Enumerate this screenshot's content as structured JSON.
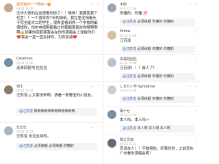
{
  "left_column": [
    {
      "username": "最爱我的个个啊咖~",
      "verified": true,
      "time": "03-24 11:06",
      "text": "汪洋大表的在这里看到你了！！啾咪！我要我我个代言！！一个喜欢你7年的妹纸，我在里沈阳看乐不完全能大二的学生，很希望看到你一个学校的都很想你，你的电视剧都看过的我都很喜欢你哪啊啊啊👍如果你回复我我会在你的演唱会上送给你们❤️我会一直一直支持你，为你加油❤️"
    },
    {
      "username": "Clearlove",
      "verified": false,
      "time": "03-24 11:06",
      "text": "连哥回复吧 拉拉拉"
    },
    {
      "username": "帅士",
      "verified": false,
      "time": "03-24 11:07",
      "text": "汪苏泷👍🏻大家快来啊。请看一条野宝的小弦友。",
      "reply_from": "@汪苏泷",
      "reply_text": "啾啾啾啾啾啾啾啾啾啾啾啾"
    },
    {
      "username": "忆忆忆",
      "verified": false,
      "time": "03-24 11:08",
      "text": "汪苏泷 永远支持你。",
      "reply_from": "@汪苏泷",
      "reply_text": "必须续期 必须续期 你懂的"
    }
  ],
  "right_column": [
    {
      "username": "不鸣",
      "verified": false,
      "time": "03-24 11:08",
      "text": "你懂的，你懂 💯",
      "reply_from": "@汪苏泷",
      "reply_text": "必须续期 你懂的 你懂的"
    },
    {
      "username": "Yellow",
      "verified": false,
      "time": "03-24 11:08",
      "text": "汪苏泷",
      "reply_from": "@汪苏泷",
      "reply_text": "必须续期 你懂的 你懂的"
    },
    {
      "username": "青溪的回忆",
      "verified": false,
      "time": "03-24 11:08",
      "text": "汪苏泷！！！真人了！",
      "reply_from": "@汪苏泷",
      "reply_text": "必须续期 你懂的 你懂的"
    },
    {
      "username": "しまたい作 Syndaime",
      "verified": false,
      "time": "03-24 11:08",
      "text": "",
      "reply_from": "@汪苏泷",
      "reply_text": "必须续期 你懂的 你懂的"
    },
    {
      "username": "陌十七",
      "verified": false,
      "time": "03-24 11:09",
      "text": "本人吗，本人吗👀",
      "reply_from": "@汪苏泷",
      "reply_text": "本人啊 本人啊 本人啊"
    },
    {
      "username": "裂之贝加",
      "verified": false,
      "time": "03-24 11:12",
      "text": "苏泷本人！！不敢相信，好喜欢你，之前还在广州看你演唱会呢！",
      "reply_from": "",
      "reply_text": ""
    }
  ],
  "actions": {
    "like": "♡",
    "reply": "⋯"
  },
  "colors": {
    "accent": "#e86a1a",
    "link": "#2a5db0",
    "badge": "#f4a018"
  }
}
